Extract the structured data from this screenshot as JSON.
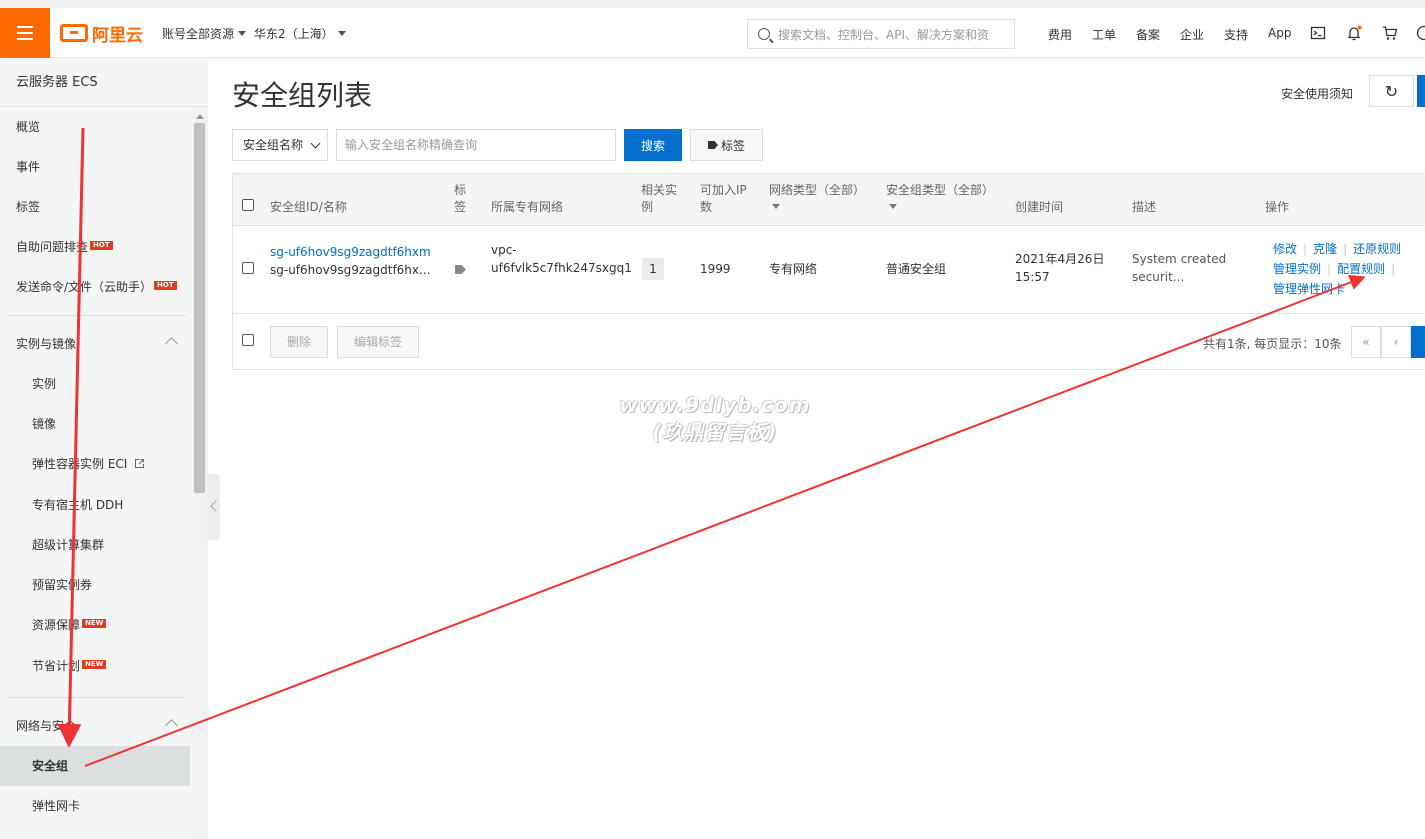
{
  "topbar": {
    "logo_text": "阿里云",
    "account_scope": "账号全部资源",
    "region": "华东2（上海）",
    "search_placeholder": "搜索文档、控制台、API、解决方案和资",
    "nav": [
      "费用",
      "工单",
      "备案",
      "企业",
      "支持",
      "App"
    ],
    "icons": [
      "terminal-icon",
      "bell-icon",
      "cart-icon",
      "help-icon"
    ],
    "accent_color": "#ff6a00"
  },
  "sidebar": {
    "title": "云服务器 ECS",
    "items_top": [
      "概览",
      "事件",
      "标签",
      "自助问题排查",
      "发送命令/文件（云助手）"
    ],
    "hot_badge": "HOT",
    "new_badge": "NEW",
    "group1": {
      "title": "实例与镜像",
      "items": [
        "实例",
        "镜像",
        "弹性容器实例 ECI",
        "专有宿主机 DDH",
        "超级计算集群",
        "预留实例券",
        "资源保障",
        "节省计划"
      ]
    },
    "group2": {
      "title": "网络与安全",
      "items": [
        "安全组",
        "弹性网卡"
      ]
    }
  },
  "main": {
    "title": "安全组列表",
    "header_link": "安全使用须知",
    "refresh_icon": "↻",
    "filter_select": "安全组名称",
    "search_placeholder": "输入安全组名称精确查询",
    "search_button": "搜索",
    "tag_button": "标签",
    "table": {
      "headers": {
        "id_name": "安全组ID/名称",
        "tag_l1": "标",
        "tag_l2": "签",
        "vpc": "所属专有网络",
        "related_l1": "相关实",
        "related_l2": "例",
        "ip_l1": "可加入IP",
        "ip_l2": "数",
        "net_type": "网络类型（全部）",
        "sg_type": "安全组类型（全部）",
        "created": "创建时间",
        "desc": "描述",
        "ops": "操作"
      },
      "row": {
        "id": "sg-uf6hov9sg9zagdtf6hxm",
        "name": "sg-uf6hov9sg9zagdtf6hx...",
        "vpc_l1": "vpc-",
        "vpc_l2": "uf6fvlk5c7fhk247sxgq1",
        "related": "1",
        "ip_count": "1999",
        "net_type": "专有网络",
        "sg_type": "普通安全组",
        "created_l1": "2021年4月26日",
        "created_l2": "15:57",
        "desc_l1": "System created",
        "desc_l2": "securit...",
        "ops": {
          "modify": "修改",
          "clone": "克隆",
          "restore": "还原规则",
          "manage_instances": "管理实例",
          "config_rules": "配置规则",
          "manage_eni": "管理弹性网卡"
        }
      },
      "footer": {
        "delete": "删除",
        "edit_tags": "编辑标签",
        "pager_text": "共有1条, 每页显示：10条",
        "first": "«",
        "prev": "‹"
      }
    }
  },
  "watermark": {
    "line1": "www.9dlyb.com",
    "line2": "(玖鼎留言板)"
  },
  "annotation_color": "#ee3333"
}
